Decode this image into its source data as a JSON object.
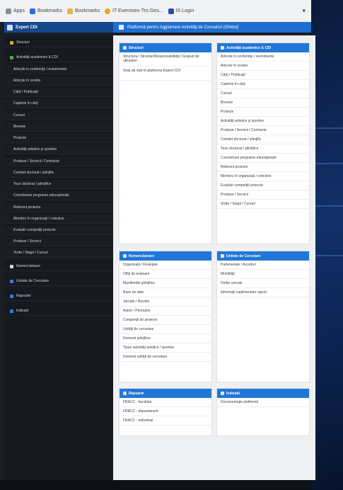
{
  "bookmarks": [
    {
      "label": "Apps",
      "icon": "apps-grid-icon",
      "color": "#8a8f98"
    },
    {
      "label": "Bookmarks",
      "icon": "star-icon",
      "color": "#2a6fd6"
    },
    {
      "label": "Bookmarks",
      "icon": "folder-icon",
      "color": "#e0b440"
    },
    {
      "label": "IT Exercises-Tro Ges...",
      "icon": "site-favicon-icon",
      "color": "#f0a020"
    },
    {
      "label": "IS Login",
      "icon": "site-login-icon",
      "color": "#2a4fa0"
    }
  ],
  "header": {
    "brand": "Expert CDI",
    "title": "Platformă pentru Aggiornare Activităţi de Convalori (Ghidul)"
  },
  "sidebar": {
    "items": [
      {
        "label": "Structuri",
        "level": 1,
        "color": "#e8a32b"
      },
      {
        "label": "Activităţi academice & CDI",
        "level": 1,
        "color": "#3fb24a"
      },
      {
        "label": "Articole in conferinţe / evenimente",
        "level": 2
      },
      {
        "label": "Articole în reviste",
        "level": 2
      },
      {
        "label": "Cărţi / Publicaţii",
        "level": 2
      },
      {
        "label": "Capitole în cărţi",
        "level": 2
      },
      {
        "label": "Cursuri",
        "level": 2
      },
      {
        "label": "Brevete",
        "level": 2
      },
      {
        "label": "Proiecte",
        "level": 2
      },
      {
        "label": "Activităţi artistice şi sportive",
        "level": 2
      },
      {
        "label": "Produse / Servicii / Contracte",
        "level": 2
      },
      {
        "label": "Comitet doctorat / ştiinţific",
        "level": 2
      },
      {
        "label": "Teze doctorat / ştiinţifice",
        "level": 2
      },
      {
        "label": "Coordonare programe educaţionale",
        "level": 2
      },
      {
        "label": "Referent proiecte",
        "level": 2
      },
      {
        "label": "Membru în organizaţii / colective",
        "level": 2
      },
      {
        "label": "Evaluări competiţii proiecte",
        "level": 2
      },
      {
        "label": "Produse / Servicii",
        "level": 2
      },
      {
        "label": "Vizite / Stagii / Cursuri",
        "level": 2
      },
      {
        "label": "Nomenclatoare",
        "level": 1,
        "color": "#d9d9d9"
      },
      {
        "label": "Unitate de Cercetare",
        "level": 1,
        "color": "#2a7fe0"
      },
      {
        "label": "Rapoarte",
        "level": 1,
        "color": "#2a7fe0"
      },
      {
        "label": "Indicatii",
        "level": 1,
        "color": "#2a7fe0"
      }
    ]
  },
  "panels": {
    "structuri": {
      "title": "Structuri",
      "items": [
        "Structura / Structuri/Responsabilităţi / Grupuri de utilizatori",
        "Strat de vizit în platforma Expert CDI"
      ]
    },
    "activitati": {
      "title": "Activităţi academice & CDI",
      "items": [
        "Articole în conferinţe / evenimente",
        "Articole în reviste",
        "Cărţi / Publicaţii",
        "Capitole în cărţi",
        "Cursuri",
        "Brevete",
        "Proiecte",
        "Activităţi artistice şi sportive",
        "Produse / Servicii / Contracte",
        "Comitet doctorat / ştiinţific",
        "Teze doctorat / ştiinţifice",
        "Coordonare programe educaţionale",
        "Referent proiecte",
        "Membru în organizaţii / colective",
        "Evaluări competiţii proiecte",
        "Produse / Servicii",
        "Vizite / Stagii / Cursuri"
      ]
    },
    "nomenclatoare": {
      "title": "Nomenclatoare",
      "items": [
        "Organizaţii / Finanţare",
        "Ofiţii de evaluare",
        "Manifestări ştiinţifice",
        "Baze de date",
        "Jurnale / Reviste",
        "Autori / Persoane",
        "Competiţii de proiecte",
        "Unităţi de cercetare",
        "Domenii ştiinţifice",
        "Tipuri activităţi artistice / sportive",
        "Domenii unităţi de cercetare"
      ]
    },
    "unitate": {
      "title": "Unitate de Cercetare",
      "items": [
        "Parteneriate / Acorduri",
        "Mobilităţi",
        "Dotări unicale",
        "Informaţii suplimentare raport"
      ]
    },
    "rapoarte": {
      "title": "Rapoarte",
      "items": [
        "FRACC - facultate",
        "FRACC - departament",
        "FRACC - individual"
      ]
    },
    "indicatii": {
      "title": "Indicatii",
      "items": [
        "Documentaţie platformă"
      ]
    }
  }
}
